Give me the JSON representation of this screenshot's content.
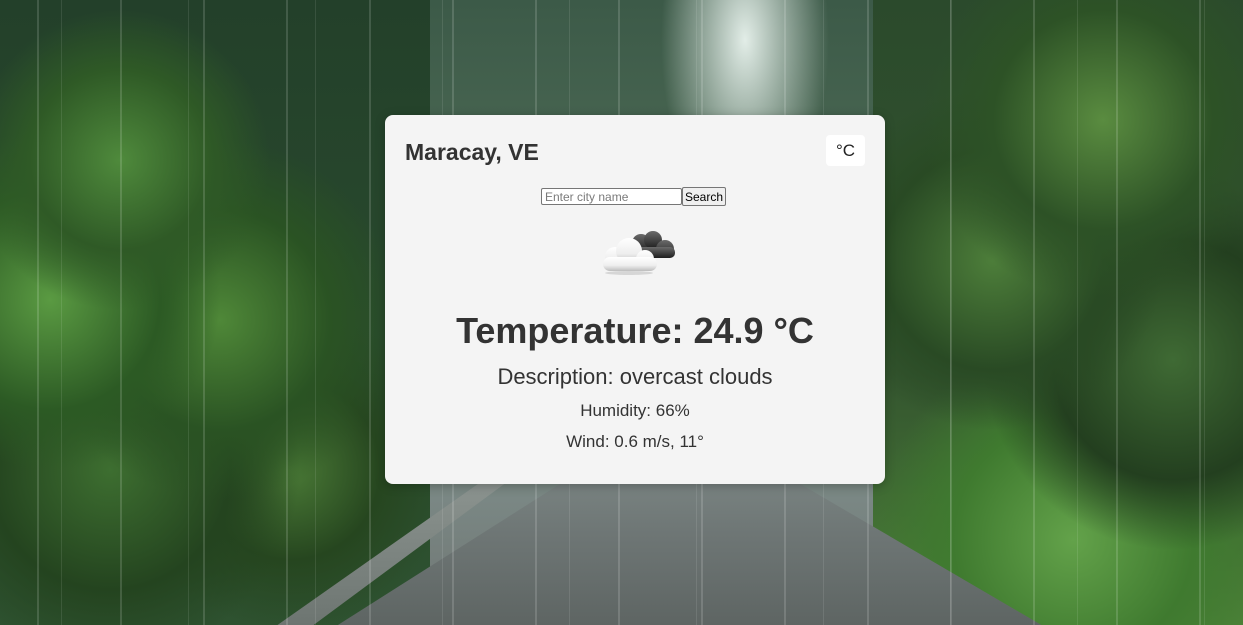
{
  "weather": {
    "city": "Maracay, VE",
    "unit_toggle_label": "°C",
    "search": {
      "placeholder": "Enter city name",
      "value": "",
      "button_label": "Search"
    },
    "icon": "overcast-clouds-icon",
    "temperature": "Temperature: 24.9 °C",
    "description": "Description: overcast clouds",
    "humidity": "Humidity: 66%",
    "wind": "Wind: 0.6 m/s, 11°"
  },
  "colors": {
    "card_background": "#f4f4f4",
    "text": "#333333"
  }
}
